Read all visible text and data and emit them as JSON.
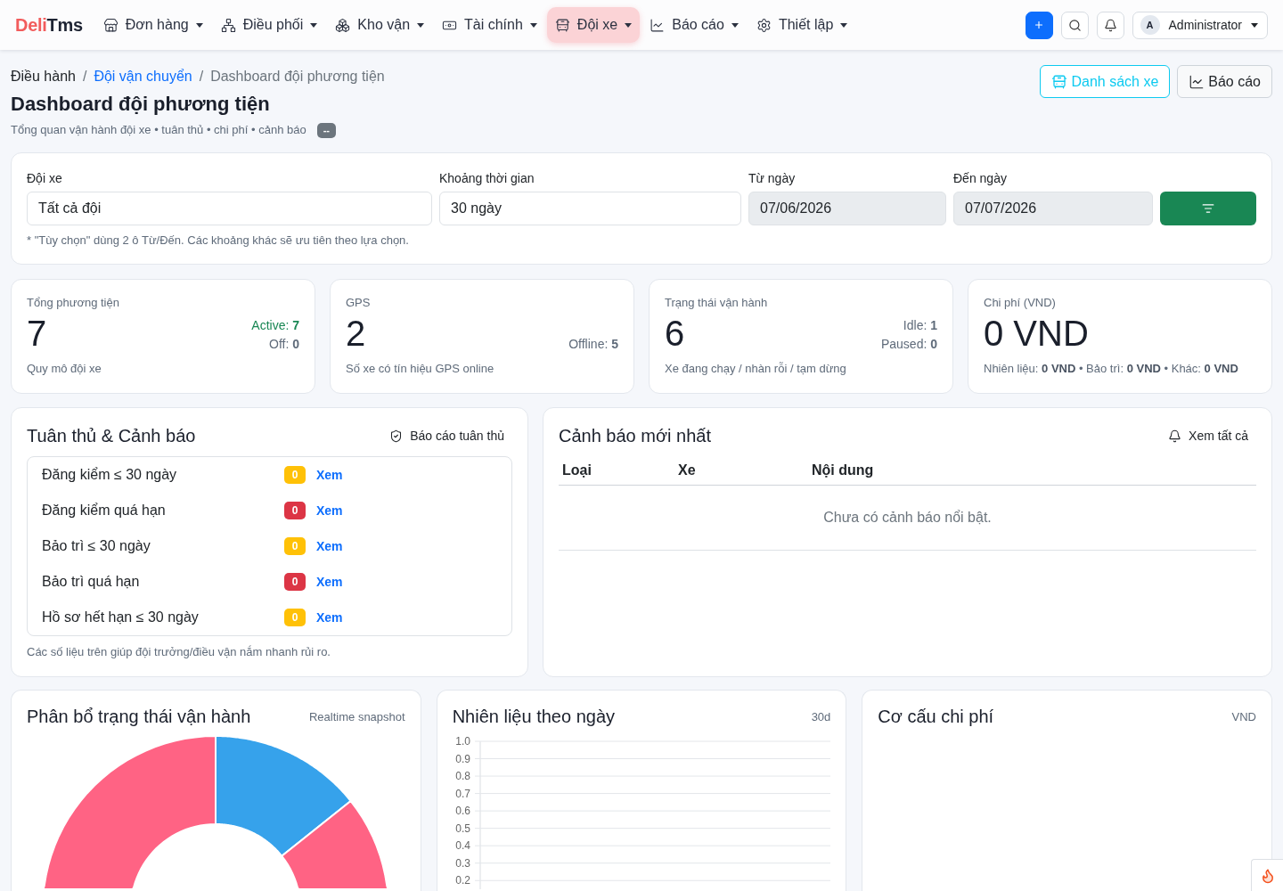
{
  "brand": {
    "accent": "Deli",
    "rest": "Tms"
  },
  "nav": [
    {
      "label": "Đơn hàng",
      "kind": "orders",
      "selected": false
    },
    {
      "label": "Điều phối",
      "kind": "dispatch",
      "selected": false
    },
    {
      "label": "Kho vận",
      "kind": "warehouse",
      "selected": false
    },
    {
      "label": "Tài chính",
      "kind": "finance",
      "selected": false
    },
    {
      "label": "Đội xe",
      "kind": "fleet",
      "selected": true
    },
    {
      "label": "Báo cáo",
      "kind": "reports",
      "selected": false
    },
    {
      "label": "Thiết lập",
      "kind": "settings",
      "selected": false
    }
  ],
  "user": {
    "initial": "A",
    "name": "Administrator"
  },
  "breadcrumb": [
    {
      "label": "Điều hành",
      "kind": "plain"
    },
    {
      "label": "/",
      "kind": "separator"
    },
    {
      "label": "Đội vận chuyển",
      "kind": "link"
    },
    {
      "label": "/",
      "kind": "separator"
    },
    {
      "label": "Dashboard đội phương tiện",
      "kind": "current"
    }
  ],
  "page": {
    "title": "Dashboard đội phương tiện",
    "subtitle": "Tổng quan vận hành đội xe • tuân thủ • chi phí • cảnh báo",
    "badge": "--",
    "actions": [
      {
        "label": "Danh sách xe",
        "kind": "info"
      },
      {
        "label": "Báo cáo",
        "kind": "secondary"
      }
    ]
  },
  "filters": {
    "fields": [
      {
        "label": "Đội xe",
        "value": "Tất cả đội",
        "disabled": false
      },
      {
        "label": "Khoảng thời gian",
        "value": "30 ngày",
        "disabled": false
      },
      {
        "label": "Từ ngày",
        "value": "07/06/2026",
        "disabled": true
      },
      {
        "label": "Đến ngày",
        "value": "07/07/2026",
        "disabled": true
      }
    ],
    "note": "* \"Tùy chọn\" dùng 2 ô Từ/Đến. Các khoảng khác sẽ ưu tiên theo lựa chọn."
  },
  "kpis": [
    {
      "label": "Tổng phương tiện",
      "value": "7",
      "caption": "Quy mô đội xe",
      "stats": [
        {
          "text": "Active: **7**",
          "kind": "success"
        },
        {
          "text": "Off: **0**",
          "kind": "muted"
        }
      ]
    },
    {
      "label": "GPS",
      "value": "2",
      "caption": "Số xe có tín hiệu GPS online",
      "stats": [
        {
          "text": "Offline: **5**",
          "kind": "muted"
        }
      ]
    },
    {
      "label": "Trạng thái vận hành",
      "value": "6",
      "caption": "Xe đang chạy / nhàn rỗi / tạm dừng",
      "stats": [
        {
          "text": "Idle: **1**",
          "kind": "muted"
        },
        {
          "text": "Paused: **0**",
          "kind": "muted"
        }
      ]
    },
    {
      "label": "Chi phí (VND)",
      "value": "0 VND",
      "caption": "Nhiên liệu: **0 VND** • Bảo trì: **0 VND** • Khác: **0 VND**"
    }
  ],
  "compliance": {
    "title": "Tuân thủ & Cảnh báo",
    "action": "Báo cáo tuân thủ",
    "items": [
      {
        "label": "Đăng kiểm ≤ 30 ngày",
        "count": "0",
        "color": "#ffc107",
        "link": "Xem"
      },
      {
        "label": "Đăng kiểm quá hạn",
        "count": "0",
        "color": "#dc3545",
        "link": "Xem"
      },
      {
        "label": "Bảo trì ≤ 30 ngày",
        "count": "0",
        "color": "#ffc107",
        "link": "Xem"
      },
      {
        "label": "Bảo trì quá hạn",
        "count": "0",
        "color": "#dc3545",
        "link": "Xem"
      },
      {
        "label": "Hồ sơ hết hạn ≤ 30 ngày",
        "count": "0",
        "color": "#ffc107",
        "link": "Xem"
      }
    ],
    "note": "Các số liệu trên giúp đội trưởng/điều vận nắm nhanh rủi ro."
  },
  "alerts": {
    "title": "Cảnh báo mới nhất",
    "action": "Xem tất cả",
    "columns": [
      "Loại",
      "Xe",
      "Nội dung"
    ],
    "empty": "Chưa có cảnh báo nổi bật."
  },
  "charts": [
    {
      "title": "Phân bổ trạng thái vận hành",
      "tag": "Realtime snapshot",
      "kind": "donut"
    },
    {
      "title": "Nhiên liệu theo ngày",
      "tag": "30d",
      "kind": "line",
      "chart_data": {
        "type": "line",
        "categories": [
          null,
          null,
          null,
          null,
          null,
          null,
          null,
          null,
          null,
          null,
          null,
          null,
          null,
          null,
          null,
          null,
          null,
          null,
          null,
          null,
          null,
          null,
          null,
          null,
          null,
          null,
          null,
          null,
          null,
          null
        ],
        "ylim": [
          0.15,
          1
        ],
        "yticks": [
          {
            "value": 0.2,
            "label": "0.2"
          },
          {
            "value": 0.3,
            "label": "0.3"
          },
          {
            "value": 0.4,
            "label": "0.4"
          },
          {
            "value": 0.5,
            "label": "0.5"
          },
          {
            "value": 0.6,
            "label": "0.6"
          },
          {
            "value": 0.7,
            "label": "0.7"
          },
          {
            "value": 0.8,
            "label": "0.8"
          },
          {
            "value": 0.9,
            "label": "0.9"
          },
          {
            "value": 1,
            "label": "1.0"
          }
        ],
        "grid": true
      }
    },
    {
      "title": "Cơ cấu chi phí",
      "tag": "VND",
      "kind": "empty"
    }
  ]
}
